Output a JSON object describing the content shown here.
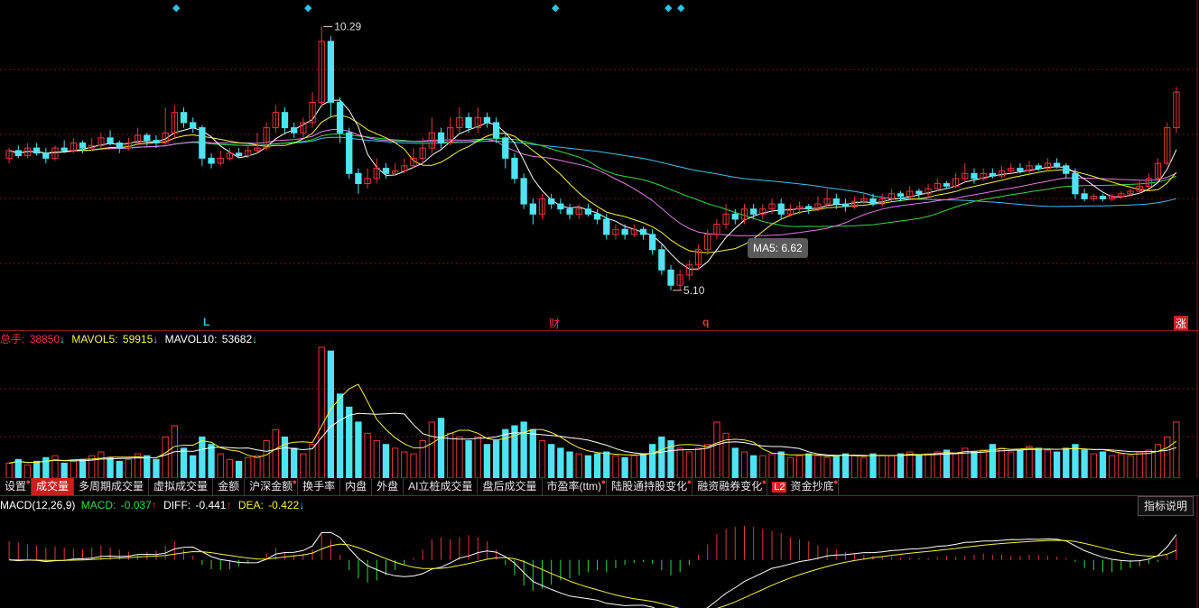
{
  "colors": {
    "up": "#e8333b",
    "down": "#4fe3f3",
    "ma5": "#ffffff",
    "ma10": "#f7f13c",
    "ma20": "#e17ae6",
    "ma30": "#2fdc46",
    "ma60": "#3cc1ef",
    "grid": "#7a1414"
  },
  "price_markers": {
    "high": "10.29",
    "low": "5.10"
  },
  "event_markers": [
    "L",
    "财",
    "q",
    "涨"
  ],
  "tooltip": "MA5: 6.62",
  "volume_info": {
    "total_label": "总手:",
    "total_value": "38850",
    "total_arrow": "↓",
    "mavol5_label": "MAVOL5:",
    "mavol5_value": "59915",
    "mavol5_arrow": "↓",
    "mavol10_label": "MAVOL10:",
    "mavol10_value": "53682",
    "mavol10_arrow": "↓"
  },
  "tabs": [
    {
      "label": "设置",
      "dot": true
    },
    {
      "label": "成交量",
      "active": true
    },
    {
      "label": "多周期成交量"
    },
    {
      "label": "虚拟成交量"
    },
    {
      "label": "金额"
    },
    {
      "label": "沪深金额",
      "dot": true
    },
    {
      "label": "换手率"
    },
    {
      "label": "内盘"
    },
    {
      "label": "外盘"
    },
    {
      "label": "AI立桩成交量"
    },
    {
      "label": "盘后成交量"
    },
    {
      "label": "市盈率(ttm)",
      "dot": true
    },
    {
      "label": "陆股通持股变化",
      "dot": true
    },
    {
      "label": "融资融券变化",
      "dot": true
    },
    {
      "label": "资金抄底",
      "dot": true,
      "badge": "L2"
    }
  ],
  "macd_info": {
    "name": "MACD(12,26,9)",
    "macd_label": "MACD:",
    "macd_value": "-0.037",
    "macd_arrow": "↑",
    "diff_label": "DIFF:",
    "diff_value": "-0.441",
    "diff_arrow": "↑",
    "dea_label": "DEA:",
    "dea_value": "-0.422",
    "dea_arrow": "↓"
  },
  "explain_button": "指标说明",
  "chart_data": {
    "type": "candlestick",
    "price_range": [
      4.6,
      10.6
    ],
    "candles": [
      [
        7.7,
        7.85,
        7.9,
        7.6
      ],
      [
        7.85,
        7.75,
        7.95,
        7.7
      ],
      [
        7.75,
        7.9,
        8.0,
        7.7
      ],
      [
        7.9,
        7.8,
        8.0,
        7.75
      ],
      [
        7.8,
        7.7,
        7.9,
        7.6
      ],
      [
        7.7,
        7.9,
        7.95,
        7.65
      ],
      [
        7.9,
        7.85,
        8.05,
        7.8
      ],
      [
        7.85,
        8.0,
        8.1,
        7.8
      ],
      [
        8.0,
        7.9,
        8.05,
        7.8
      ],
      [
        7.9,
        7.95,
        8.1,
        7.85
      ],
      [
        7.95,
        8.1,
        8.2,
        7.9
      ],
      [
        8.1,
        8.0,
        8.25,
        7.95
      ],
      [
        8.0,
        7.9,
        8.05,
        7.8
      ],
      [
        7.9,
        8.0,
        8.1,
        7.85
      ],
      [
        8.0,
        8.15,
        8.3,
        7.95
      ],
      [
        8.15,
        8.05,
        8.2,
        7.95
      ],
      [
        8.05,
        8.0,
        8.15,
        7.9
      ],
      [
        8.0,
        8.2,
        8.7,
        7.95
      ],
      [
        8.2,
        8.6,
        8.75,
        8.1
      ],
      [
        8.6,
        8.4,
        8.7,
        8.3
      ],
      [
        8.4,
        8.3,
        8.5,
        8.2
      ],
      [
        8.3,
        7.7,
        8.35,
        7.55
      ],
      [
        7.7,
        7.6,
        7.8,
        7.5
      ],
      [
        7.6,
        7.7,
        7.85,
        7.55
      ],
      [
        7.7,
        7.8,
        7.9,
        7.65
      ],
      [
        7.8,
        7.75,
        7.9,
        7.7
      ],
      [
        7.75,
        7.85,
        7.95,
        7.7
      ],
      [
        7.85,
        7.9,
        8.2,
        7.8
      ],
      [
        7.9,
        8.3,
        8.4,
        7.85
      ],
      [
        8.3,
        8.6,
        8.75,
        8.2
      ],
      [
        8.6,
        8.3,
        8.7,
        8.2
      ],
      [
        8.3,
        8.2,
        8.4,
        8.1
      ],
      [
        8.2,
        8.4,
        8.5,
        8.1
      ],
      [
        8.4,
        8.8,
        9.0,
        8.3
      ],
      [
        8.8,
        10.0,
        10.29,
        8.7
      ],
      [
        10.0,
        8.8,
        10.1,
        8.5
      ],
      [
        8.8,
        8.2,
        8.9,
        8.0
      ],
      [
        8.2,
        7.4,
        8.3,
        7.3
      ],
      [
        7.4,
        7.2,
        7.5,
        7.0
      ],
      [
        7.2,
        7.3,
        7.5,
        7.1
      ],
      [
        7.3,
        7.5,
        7.7,
        7.2
      ],
      [
        7.5,
        7.4,
        7.6,
        7.3
      ],
      [
        7.4,
        7.45,
        7.6,
        7.35
      ],
      [
        7.45,
        7.55,
        7.7,
        7.4
      ],
      [
        7.55,
        7.7,
        7.9,
        7.5
      ],
      [
        7.7,
        7.9,
        8.1,
        7.6
      ],
      [
        7.9,
        8.2,
        8.5,
        7.8
      ],
      [
        8.2,
        8.0,
        8.3,
        7.9
      ],
      [
        8.0,
        8.3,
        8.5,
        7.95
      ],
      [
        8.3,
        8.5,
        8.7,
        8.2
      ],
      [
        8.5,
        8.3,
        8.6,
        8.2
      ],
      [
        8.3,
        8.5,
        8.7,
        8.2
      ],
      [
        8.5,
        8.4,
        8.6,
        8.3
      ],
      [
        8.4,
        8.1,
        8.5,
        8.0
      ],
      [
        8.1,
        7.7,
        8.2,
        7.5
      ],
      [
        7.7,
        7.3,
        7.8,
        7.2
      ],
      [
        7.3,
        6.8,
        7.4,
        6.7
      ],
      [
        6.8,
        6.6,
        6.9,
        6.4
      ],
      [
        6.6,
        6.9,
        7.0,
        6.5
      ],
      [
        6.9,
        6.8,
        7.0,
        6.7
      ],
      [
        6.8,
        6.7,
        6.9,
        6.6
      ],
      [
        6.7,
        6.6,
        6.8,
        6.5
      ],
      [
        6.6,
        6.7,
        6.8,
        6.5
      ],
      [
        6.7,
        6.6,
        6.8,
        6.55
      ],
      [
        6.6,
        6.5,
        6.7,
        6.4
      ],
      [
        6.5,
        6.2,
        6.6,
        6.1
      ],
      [
        6.2,
        6.3,
        6.4,
        6.1
      ],
      [
        6.3,
        6.2,
        6.4,
        6.1
      ],
      [
        6.2,
        6.3,
        6.4,
        6.15
      ],
      [
        6.3,
        6.2,
        6.35,
        6.1
      ],
      [
        6.2,
        5.9,
        6.3,
        5.8
      ],
      [
        5.9,
        5.5,
        6.0,
        5.4
      ],
      [
        5.5,
        5.2,
        5.6,
        5.1
      ],
      [
        5.2,
        5.4,
        5.5,
        5.1
      ],
      [
        5.4,
        5.6,
        5.7,
        5.3
      ],
      [
        5.6,
        5.9,
        6.0,
        5.5
      ],
      [
        5.9,
        6.2,
        6.3,
        5.8
      ],
      [
        6.2,
        6.4,
        6.5,
        6.1
      ],
      [
        6.4,
        6.6,
        6.8,
        6.3
      ],
      [
        6.6,
        6.5,
        6.7,
        6.4
      ],
      [
        6.5,
        6.7,
        6.8,
        6.4
      ],
      [
        6.7,
        6.6,
        6.8,
        6.5
      ],
      [
        6.6,
        6.7,
        6.8,
        6.5
      ],
      [
        6.7,
        6.8,
        6.9,
        6.6
      ],
      [
        6.8,
        6.6,
        6.9,
        6.5
      ],
      [
        6.6,
        6.7,
        6.8,
        6.55
      ],
      [
        6.7,
        6.75,
        6.85,
        6.6
      ],
      [
        6.75,
        6.7,
        6.8,
        6.6
      ],
      [
        6.7,
        6.8,
        6.95,
        6.65
      ],
      [
        6.8,
        6.9,
        7.1,
        6.75
      ],
      [
        6.9,
        6.8,
        7.0,
        6.7
      ],
      [
        6.8,
        6.75,
        6.9,
        6.65
      ],
      [
        6.75,
        6.85,
        6.95,
        6.7
      ],
      [
        6.85,
        6.9,
        7.0,
        6.8
      ],
      [
        6.9,
        6.8,
        7.0,
        6.75
      ],
      [
        6.8,
        6.9,
        7.0,
        6.75
      ],
      [
        6.9,
        7.0,
        7.1,
        6.85
      ],
      [
        7.0,
        6.95,
        7.05,
        6.85
      ],
      [
        6.95,
        7.05,
        7.15,
        6.9
      ],
      [
        7.05,
        7.0,
        7.1,
        6.9
      ],
      [
        7.0,
        7.1,
        7.2,
        6.95
      ],
      [
        7.1,
        7.2,
        7.3,
        7.05
      ],
      [
        7.2,
        7.15,
        7.25,
        7.1
      ],
      [
        7.15,
        7.3,
        7.4,
        7.1
      ],
      [
        7.3,
        7.4,
        7.6,
        7.25
      ],
      [
        7.4,
        7.3,
        7.5,
        7.2
      ],
      [
        7.3,
        7.4,
        7.5,
        7.25
      ],
      [
        7.4,
        7.35,
        7.5,
        7.3
      ],
      [
        7.35,
        7.45,
        7.55,
        7.3
      ],
      [
        7.45,
        7.5,
        7.6,
        7.4
      ],
      [
        7.5,
        7.45,
        7.6,
        7.4
      ],
      [
        7.45,
        7.55,
        7.65,
        7.4
      ],
      [
        7.55,
        7.5,
        7.6,
        7.45
      ],
      [
        7.5,
        7.6,
        7.7,
        7.45
      ],
      [
        7.6,
        7.55,
        7.7,
        7.5
      ],
      [
        7.55,
        7.4,
        7.6,
        7.3
      ],
      [
        7.4,
        7.0,
        7.5,
        6.9
      ],
      [
        7.0,
        6.9,
        7.1,
        6.85
      ],
      [
        6.9,
        6.95,
        7.0,
        6.85
      ],
      [
        6.95,
        6.9,
        7.0,
        6.85
      ],
      [
        6.9,
        6.95,
        7.0,
        6.85
      ],
      [
        6.95,
        7.0,
        7.05,
        6.9
      ],
      [
        7.0,
        7.05,
        7.1,
        6.95
      ],
      [
        7.05,
        7.15,
        7.25,
        7.0
      ],
      [
        7.15,
        7.3,
        7.4,
        7.1
      ],
      [
        7.3,
        7.6,
        7.7,
        7.25
      ],
      [
        7.6,
        8.3,
        8.4,
        7.55
      ],
      [
        8.3,
        9.0,
        9.1,
        8.2
      ]
    ],
    "volumes": [
      8,
      10,
      7,
      9,
      11,
      12,
      8,
      9,
      10,
      12,
      14,
      11,
      9,
      10,
      13,
      12,
      10,
      22,
      28,
      16,
      12,
      22,
      18,
      13,
      10,
      9,
      11,
      12,
      20,
      26,
      22,
      16,
      13,
      18,
      70,
      68,
      45,
      38,
      30,
      24,
      20,
      18,
      16,
      14,
      13,
      20,
      30,
      32,
      24,
      22,
      20,
      22,
      18,
      20,
      26,
      28,
      30,
      26,
      20,
      18,
      16,
      14,
      13,
      12,
      13,
      14,
      12,
      11,
      12,
      13,
      18,
      22,
      20,
      16,
      14,
      16,
      18,
      30,
      24,
      16,
      14,
      12,
      12,
      13,
      14,
      11,
      12,
      13,
      12,
      11,
      12,
      13,
      12,
      11,
      13,
      12,
      12,
      13,
      14,
      12,
      13,
      14,
      15,
      13,
      16,
      14,
      15,
      18,
      16,
      14,
      15,
      17,
      16,
      15,
      14,
      16,
      18,
      15,
      13,
      14,
      12,
      13,
      12,
      14,
      15,
      18,
      22,
      30
    ],
    "macd_hist": [
      0.18,
      0.17,
      0.15,
      0.14,
      0.12,
      0.13,
      0.12,
      0.11,
      0.1,
      0.12,
      0.14,
      0.12,
      0.1,
      0.08,
      0.06,
      0.08,
      0.09,
      0.14,
      0.18,
      0.1,
      0.04,
      -0.05,
      -0.09,
      -0.1,
      -0.09,
      -0.06,
      -0.03,
      0.01,
      0.06,
      0.12,
      0.08,
      0.05,
      0.06,
      0.1,
      0.25,
      0.2,
      0.05,
      -0.1,
      -0.18,
      -0.22,
      -0.2,
      -0.15,
      -0.1,
      -0.05,
      0.02,
      0.1,
      0.2,
      0.22,
      0.2,
      0.22,
      0.24,
      0.22,
      0.18,
      0.1,
      -0.05,
      -0.15,
      -0.25,
      -0.3,
      -0.28,
      -0.24,
      -0.2,
      -0.18,
      -0.15,
      -0.12,
      -0.1,
      -0.12,
      -0.08,
      -0.05,
      -0.03,
      -0.02,
      -0.04,
      -0.1,
      -0.15,
      -0.12,
      -0.05,
      0.05,
      0.15,
      0.25,
      0.3,
      0.32,
      0.33,
      0.32,
      0.3,
      0.28,
      0.26,
      0.22,
      0.2,
      0.18,
      0.14,
      0.12,
      0.1,
      0.08,
      0.06,
      0.05,
      0.04,
      0.03,
      0.03,
      0.02,
      0.02,
      0.02,
      0.02,
      0.03,
      0.04,
      0.03,
      0.04,
      0.05,
      0.06,
      0.05,
      0.05,
      0.04,
      0.04,
      0.05,
      0.05,
      0.04,
      0.03,
      0.02,
      -0.02,
      -0.08,
      -0.1,
      -0.12,
      -0.12,
      -0.1,
      -0.08,
      -0.06,
      -0.04,
      -0.02,
      0.05,
      0.22
    ],
    "macd_range": [
      -0.45,
      0.4
    ]
  }
}
